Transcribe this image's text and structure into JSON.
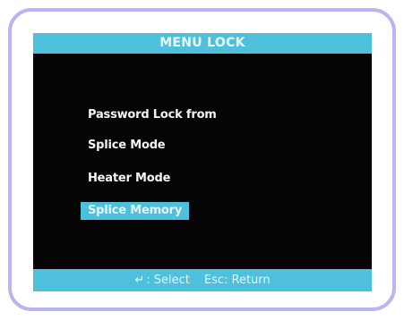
{
  "title": "MENU LOCK",
  "menu": {
    "heading": "Password Lock from",
    "items": [
      {
        "label": "Splice Mode",
        "selected": false
      },
      {
        "label": "Heater Mode",
        "selected": false
      },
      {
        "label": "Splice Memory",
        "selected": true
      }
    ]
  },
  "footer": {
    "enter_icon": "↵",
    "select_label": ": Select",
    "return_label": "Esc: Return"
  },
  "colors": {
    "bezel": "#b8b6ee",
    "screen": "#050505",
    "accent_bar": "#4fc0dc",
    "text": "#f4f4f4"
  }
}
